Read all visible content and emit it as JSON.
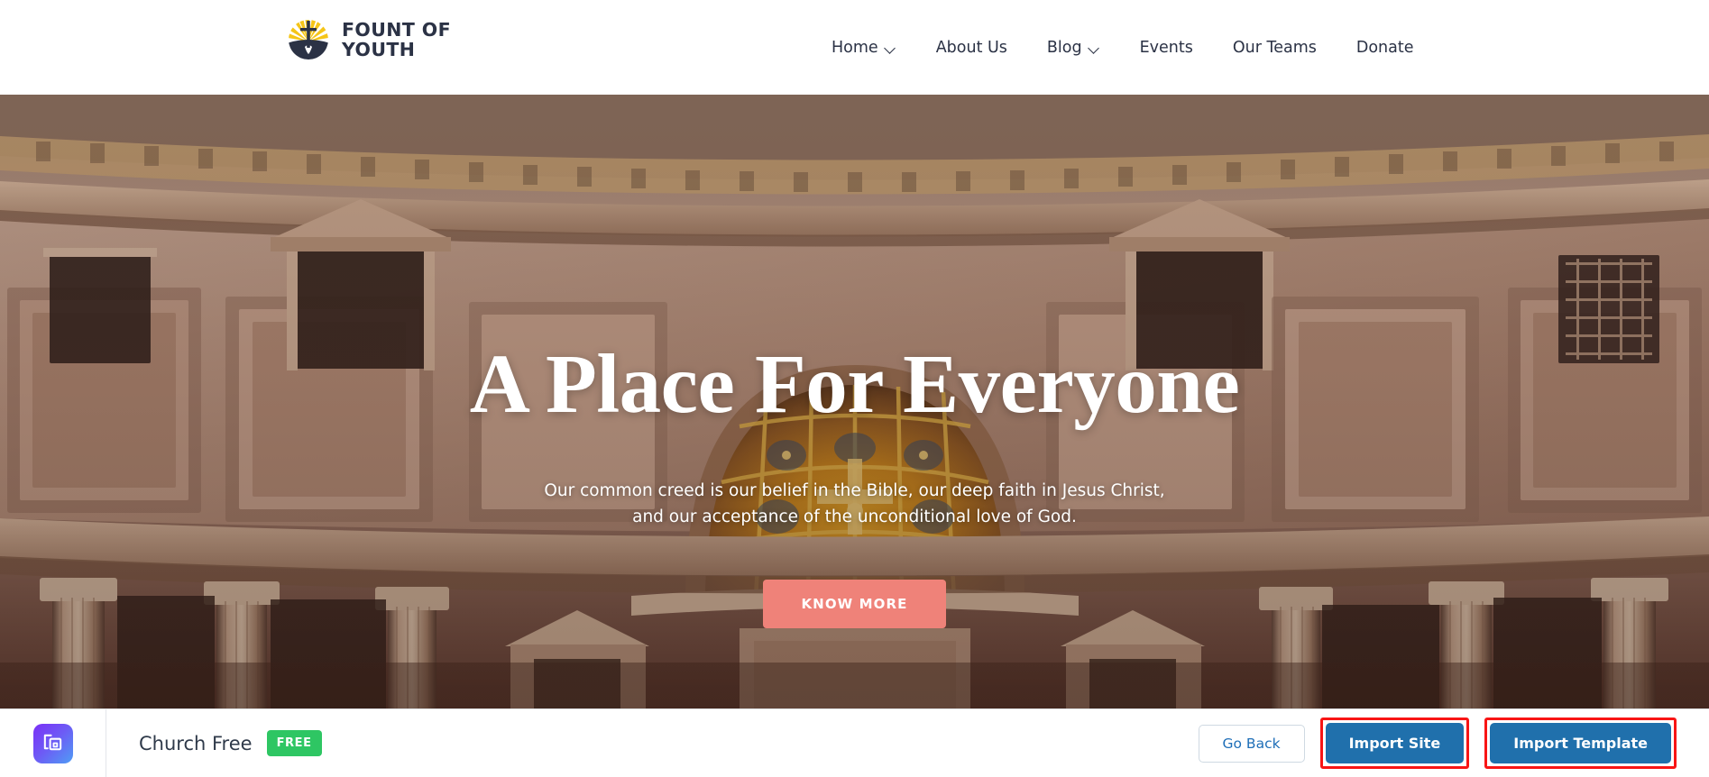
{
  "header": {
    "brand": {
      "icon": "church-sunrise-cross-logo",
      "line1": "FOUNT OF",
      "line2": "YOUTH"
    },
    "nav": [
      {
        "label": "Home",
        "has_dropdown": true,
        "icon": "chevron-down-icon"
      },
      {
        "label": "About Us",
        "has_dropdown": false
      },
      {
        "label": "Blog",
        "has_dropdown": true,
        "icon": "chevron-down-icon"
      },
      {
        "label": "Events",
        "has_dropdown": false
      },
      {
        "label": "Our Teams",
        "has_dropdown": false
      },
      {
        "label": "Donate",
        "has_dropdown": false
      }
    ]
  },
  "hero": {
    "title": "A Place For Everyone",
    "subtitle_line1": "Our common creed is our belief in the Bible, our deep faith in Jesus Christ,",
    "subtitle_line2": "and our acceptance of the unconditional love of God.",
    "cta_label": "KNOW MORE",
    "cta_color": "#ef8279",
    "background_description": "Interior of a classical domed basilica with marble panels and a gilded mosaic apse"
  },
  "action_bar": {
    "app_icon": "template-import-icon",
    "template_name": "Church Free",
    "badge_label": "FREE",
    "badge_color": "#2ec663",
    "buttons": [
      {
        "label": "Go Back",
        "style": "secondary",
        "highlighted": false
      },
      {
        "label": "Import Site",
        "style": "primary",
        "highlighted": true
      },
      {
        "label": "Import Template",
        "style": "primary",
        "highlighted": true
      }
    ],
    "highlight_color": "#f81515",
    "primary_color": "#2070ac"
  }
}
